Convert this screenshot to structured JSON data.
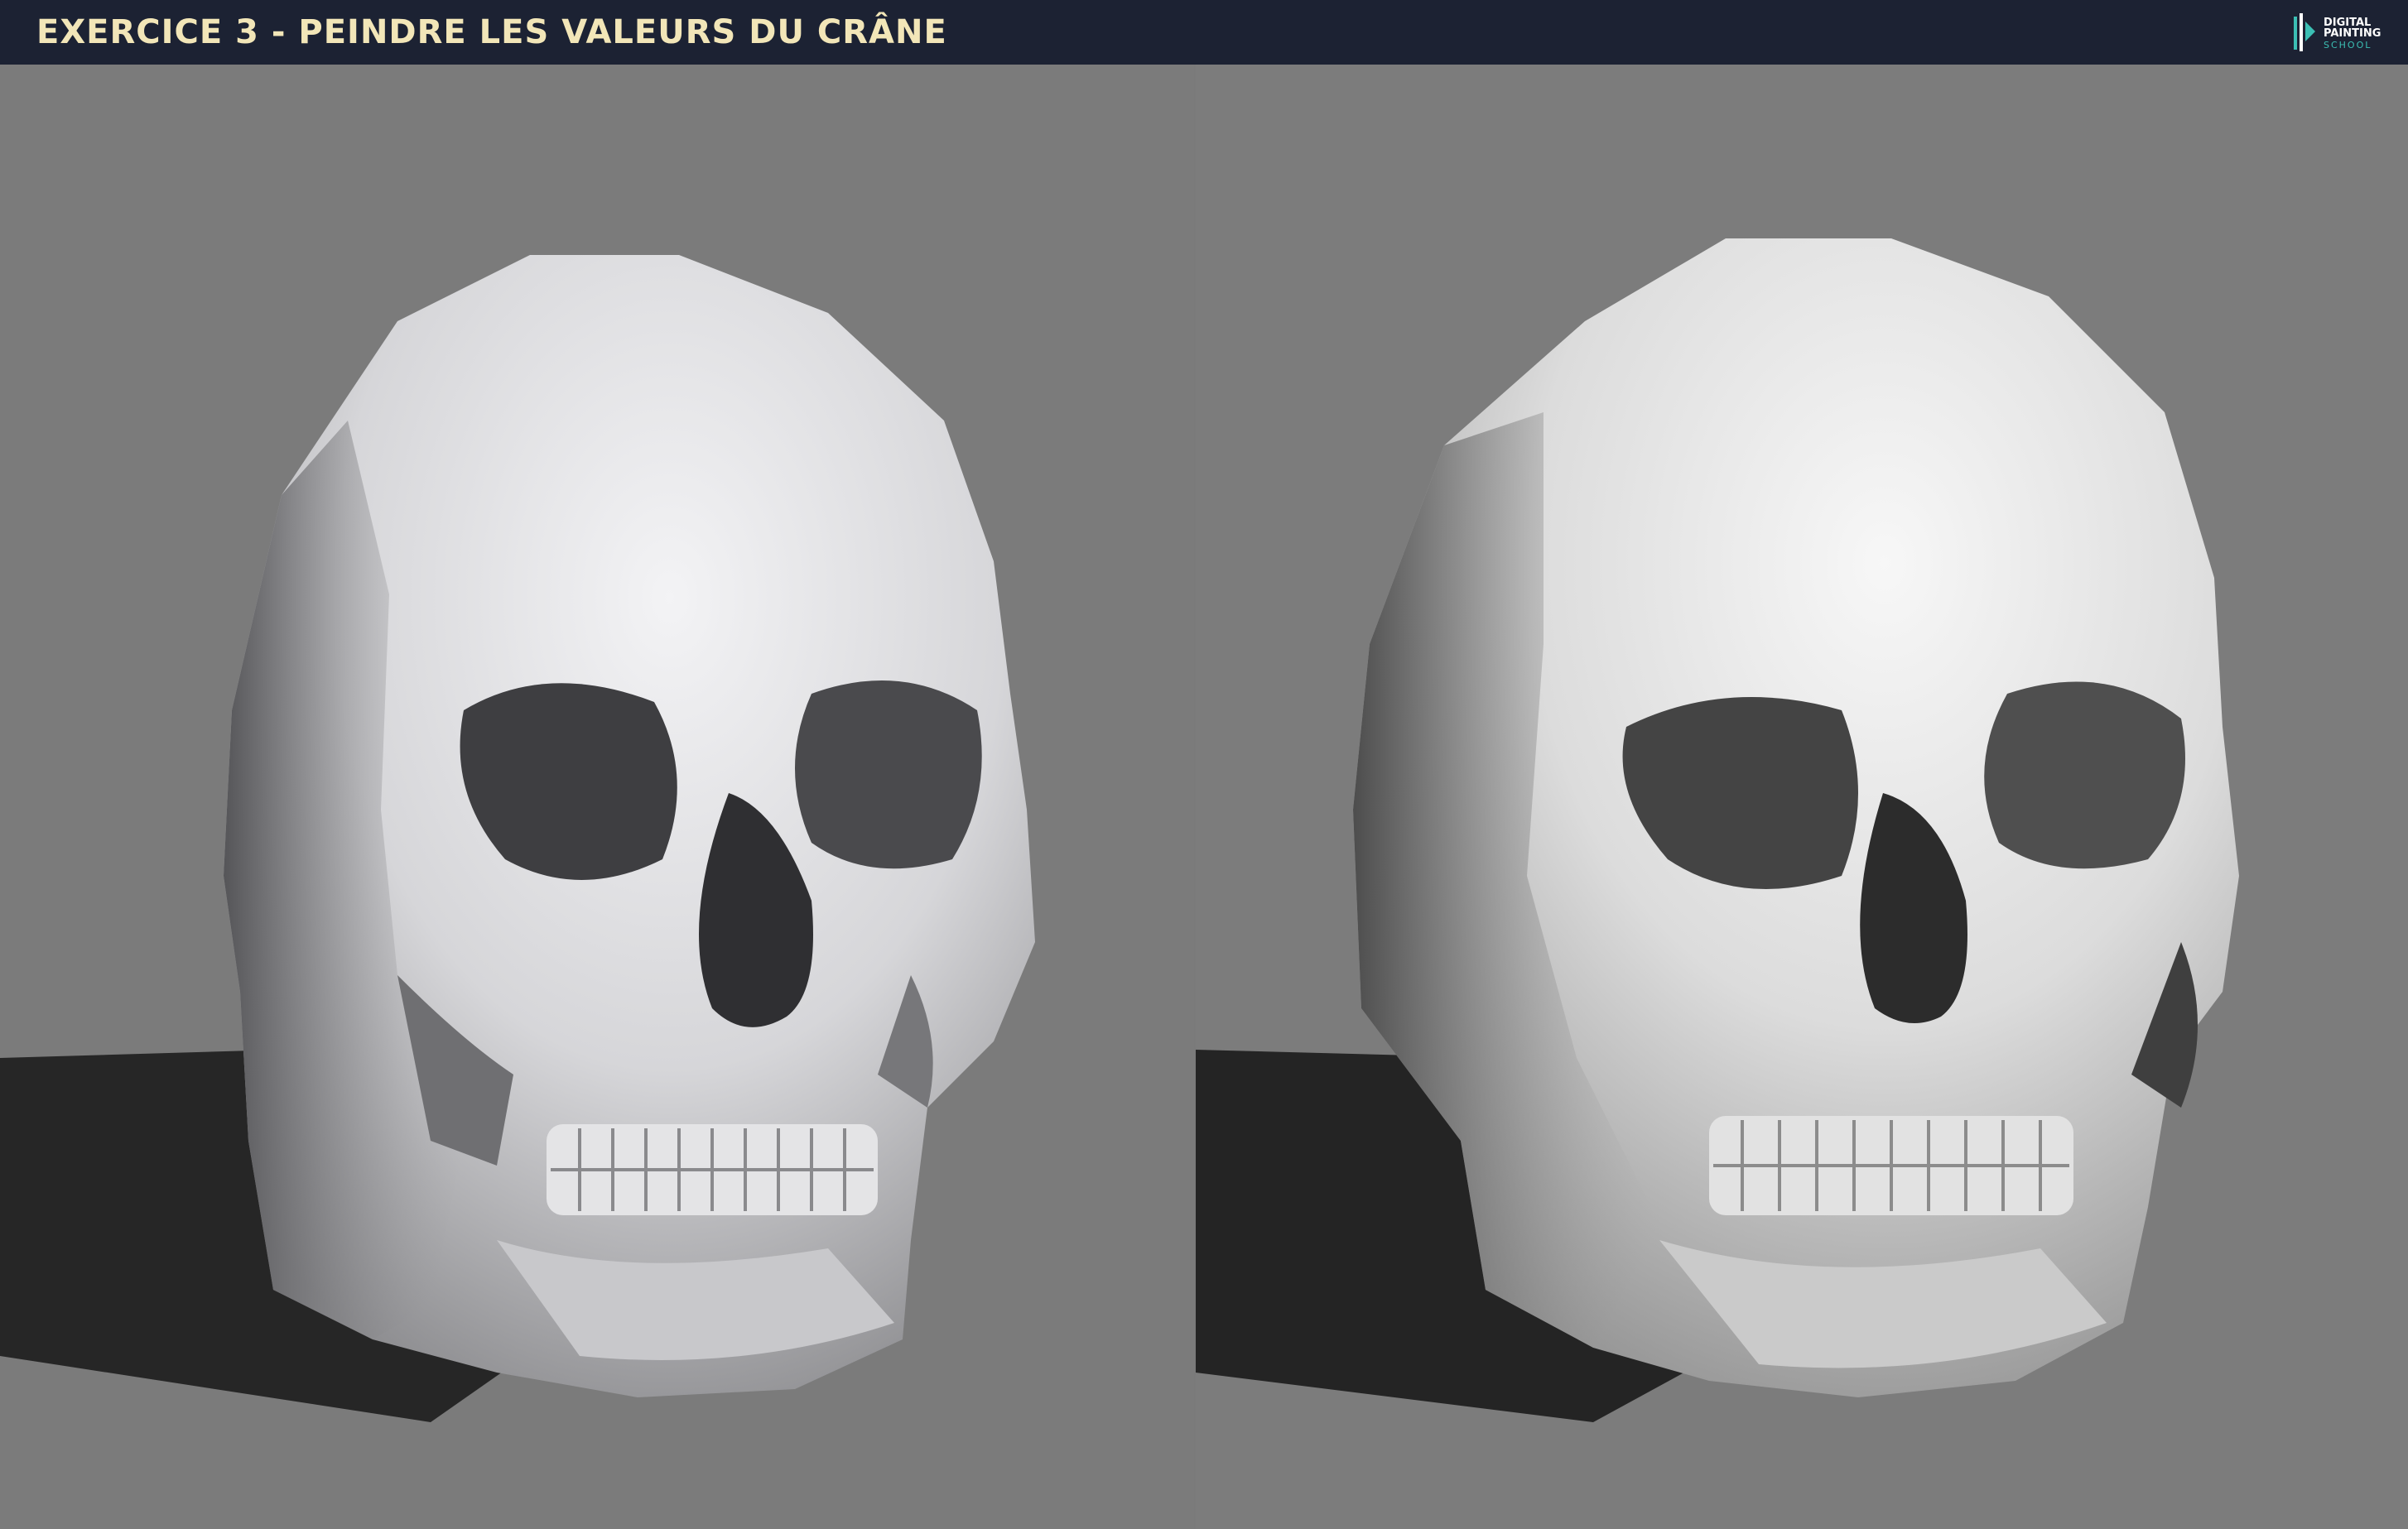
{
  "header": {
    "title": "EXERCICE 3 - PEINDRE LES VALEURS DU CRÂNE",
    "logo": {
      "line1": "DIGITAL",
      "line2": "PAINTING",
      "line3": "SCHOOL",
      "icon": "brush-logo-icon"
    }
  },
  "panels": [
    {
      "name": "reference-3d-skull",
      "icon": "skull-icon"
    },
    {
      "name": "painted-skull-study",
      "icon": "skull-icon"
    }
  ],
  "colors": {
    "banner": "#1c2233",
    "title": "#f2e6b8",
    "background": "#7a7a7a",
    "shadow": "#262626",
    "bone_light": "#ededee",
    "bone_mid": "#bdbdbf",
    "bone_dark": "#4a4a4c",
    "logo_accent": "#3bbfb4"
  }
}
